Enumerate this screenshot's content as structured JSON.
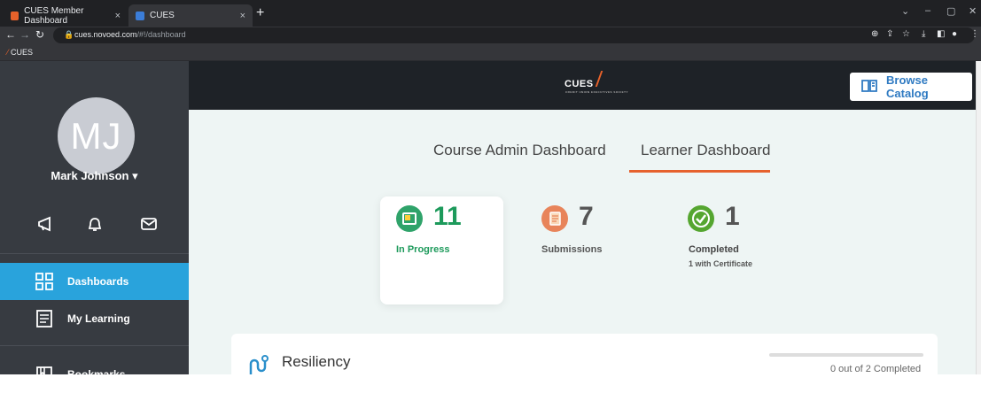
{
  "browser": {
    "tabs": [
      {
        "label": "CUES Member Dashboard",
        "close": "×"
      },
      {
        "label": "CUES",
        "close": "×"
      }
    ],
    "new_tab": "+",
    "url_host": "cues.novoed.com",
    "url_path": "/#!/dashboard",
    "bookmark": "CUES",
    "window_controls": [
      "⌄",
      "–",
      "▢",
      "✕"
    ]
  },
  "sidebar": {
    "initials": "MJ",
    "user_name": "Mark Johnson ▾",
    "icons": [
      "megaphone-icon",
      "bell-icon",
      "mail-icon"
    ],
    "items": [
      {
        "label": "Dashboards",
        "active": true
      },
      {
        "label": "My Learning",
        "active": false
      },
      {
        "label": "Bookmarks",
        "active": false
      }
    ]
  },
  "header": {
    "logo": "CUES",
    "logo_tagline": "CREDIT UNION EXECUTIVES SOCIETY",
    "browse_label": "Browse Catalog"
  },
  "dashboard": {
    "tabs": [
      "Course Admin Dashboard",
      "Learner Dashboard"
    ],
    "active_tab": "Learner Dashboard",
    "accent": "#e6612d",
    "stats": [
      {
        "count": "11",
        "label": "In Progress",
        "color": "#1d9a5b"
      },
      {
        "count": "7",
        "label": "Submissions",
        "color": "#e8845a"
      },
      {
        "count": "1",
        "label": "Completed",
        "sub": "1 with Certificate",
        "color": "#55a630"
      }
    ]
  },
  "course": {
    "title": "Resiliency",
    "progress_text": "0 out of 2 Completed",
    "progress_fraction": 0
  }
}
